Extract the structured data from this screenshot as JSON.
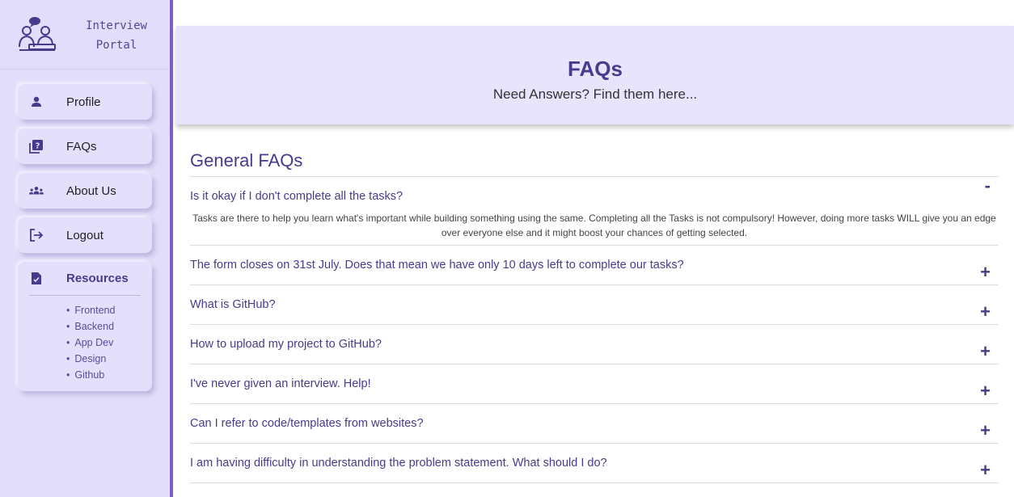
{
  "brand": {
    "title_line1": "Interview",
    "title_line2": "Portal",
    "logo_icon": "interview-people-icon"
  },
  "nav": {
    "profile": {
      "label": "Profile",
      "icon": "person-icon"
    },
    "faqs": {
      "label": "FAQs",
      "icon": "question-book-icon"
    },
    "about": {
      "label": "About Us",
      "icon": "users-icon"
    },
    "logout": {
      "label": "Logout",
      "icon": "logout-icon"
    }
  },
  "resources": {
    "label": "Resources",
    "icon": "document-check-icon",
    "items": [
      "Frontend",
      "Backend",
      "App Dev",
      "Design",
      "Github"
    ]
  },
  "hero": {
    "title": "FAQs",
    "subtitle": "Need Answers? Find them here..."
  },
  "main": {
    "section_title": "General FAQs",
    "faqs": [
      {
        "question": "Is it okay if I don't complete all the tasks?",
        "answer": "Tasks are there to help you learn what's important while building something using the same. Completing all the Tasks is not compulsory! However, doing more tasks WILL give you an edge over everyone else and it might boost your chances of getting selected.",
        "toggle": "-"
      },
      {
        "question": "The form closes on 31st July. Does that mean we have only 10 days left to complete our tasks?",
        "toggle": "+"
      },
      {
        "question": "What is GitHub?",
        "toggle": "+"
      },
      {
        "question": "How to upload my project to GitHub?",
        "toggle": "+"
      },
      {
        "question": "I've never given an interview. Help!",
        "toggle": "+"
      },
      {
        "question": "Can I refer to code/templates from websites?",
        "toggle": "+"
      },
      {
        "question": "I am having difficulty in understanding the problem statement. What should I do?",
        "toggle": "+"
      }
    ]
  },
  "colors": {
    "accent": "#4a3a8c",
    "sidebar_bg": "#e1ddfa",
    "hero_bg": "#e8e4fc",
    "border_accent": "#7a5fc9"
  }
}
